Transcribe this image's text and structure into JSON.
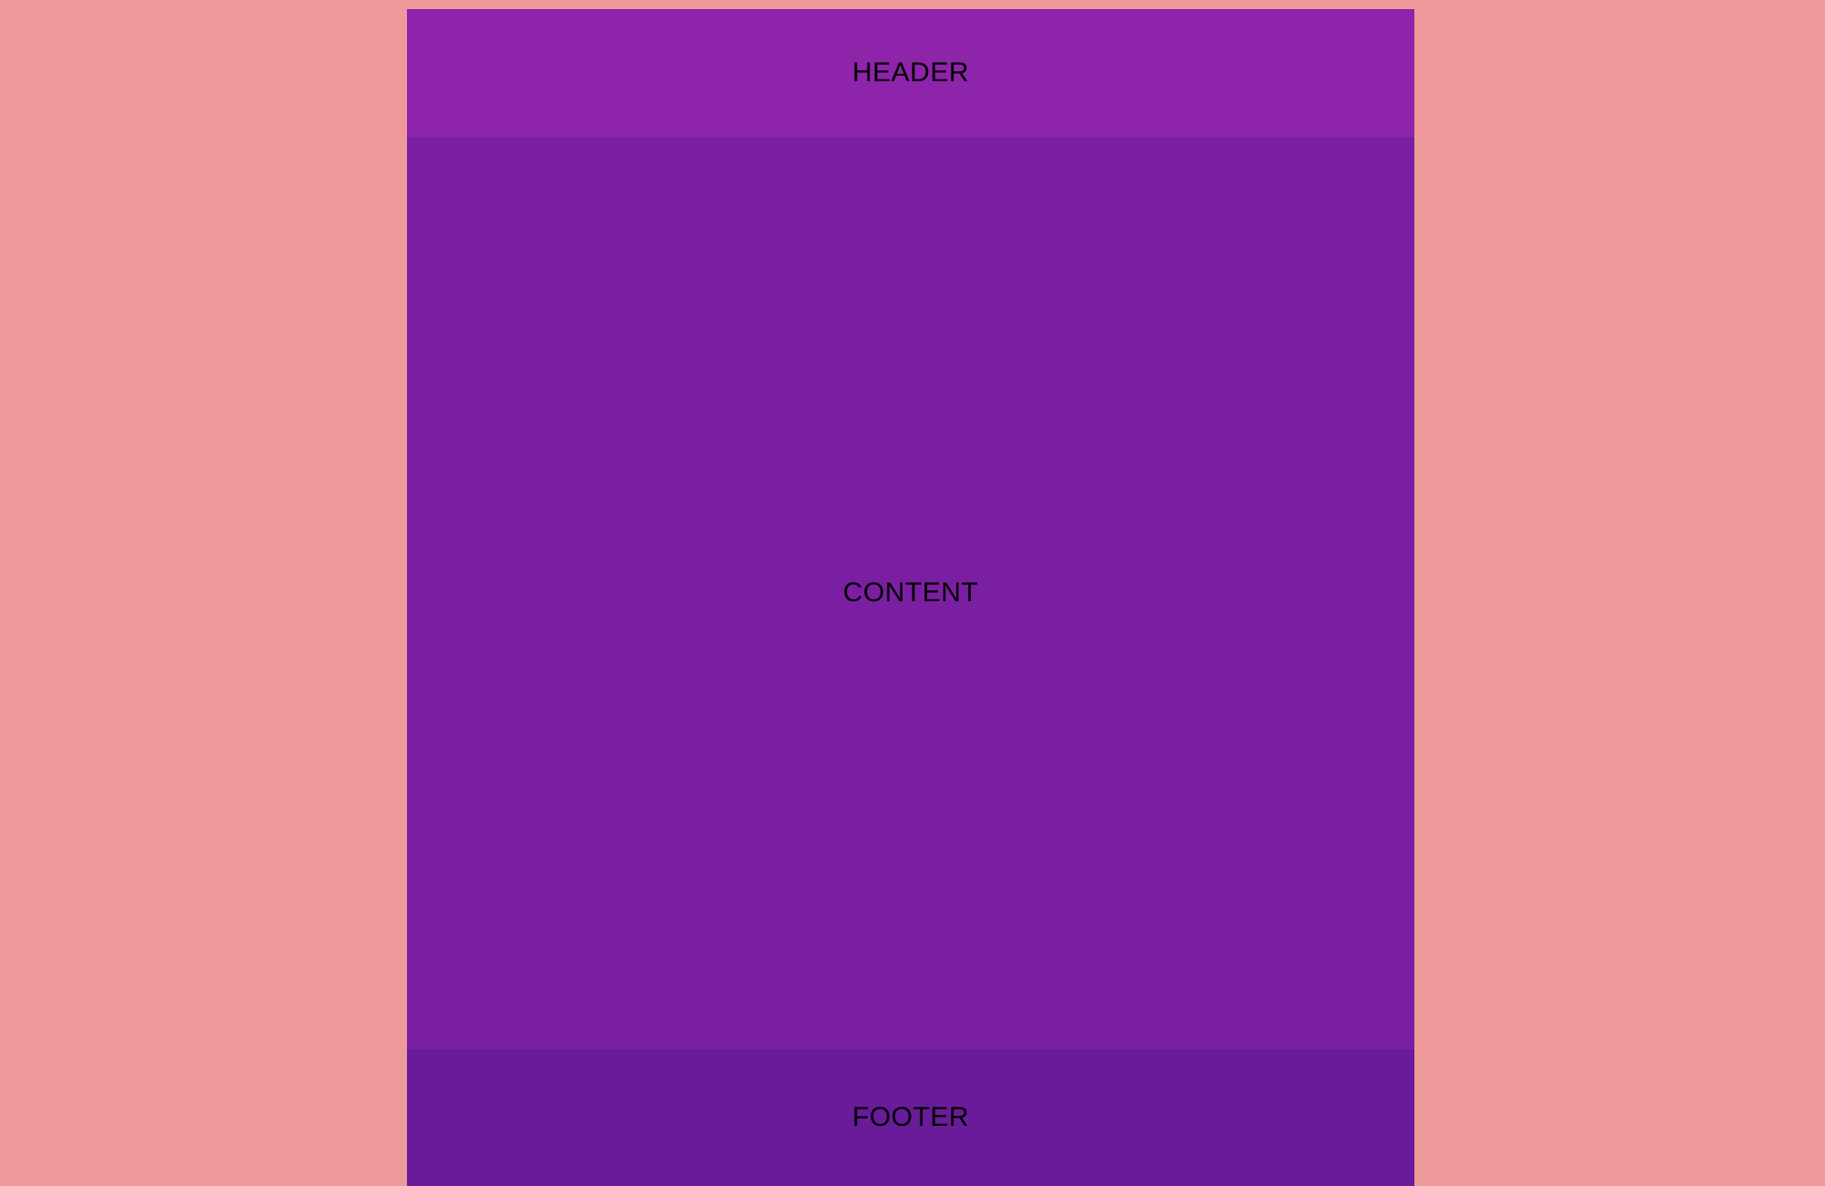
{
  "page": {
    "background_color": "#ee9a9a"
  },
  "header": {
    "label": "HEADER",
    "color": "#8e24aa"
  },
  "content": {
    "label": "CONTENT",
    "color": "#7b1fa2"
  },
  "footer": {
    "label": "FOOTER",
    "color": "#6a1b9a"
  }
}
